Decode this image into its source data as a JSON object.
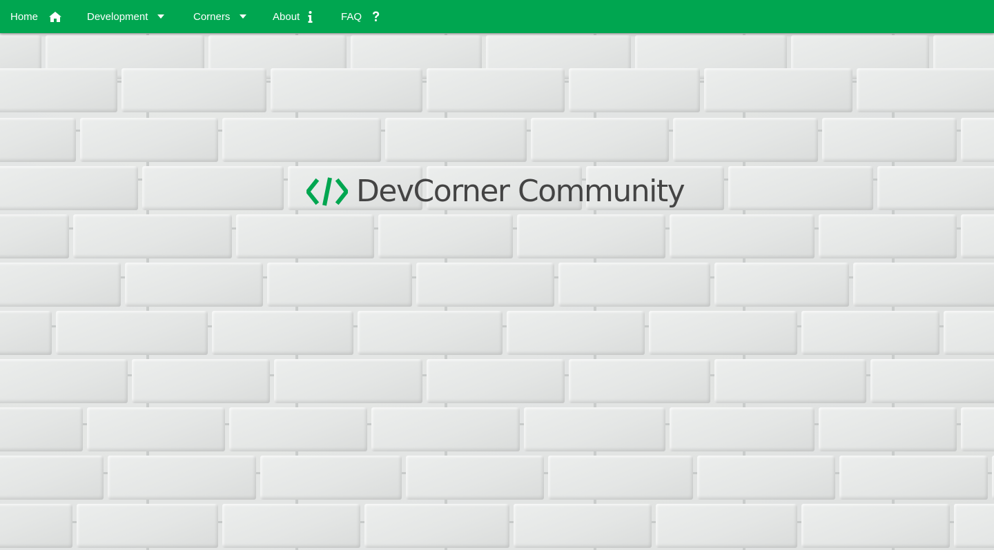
{
  "navbar": {
    "background_color": "#00a650",
    "items": [
      {
        "label": "Home",
        "icon": "home-icon"
      },
      {
        "label": "Development",
        "icon": "caret-down-icon"
      },
      {
        "label": "Corners",
        "icon": "caret-down-icon"
      },
      {
        "label": "About",
        "icon": "info-icon"
      },
      {
        "label": "FAQ",
        "icon": "question-icon"
      }
    ]
  },
  "hero": {
    "logo_icon": "code-brackets-icon",
    "logo_color": "#00a650",
    "title": "DevCorner Community",
    "title_color": "#444444"
  },
  "background": {
    "pattern": "white-brick-wall"
  }
}
